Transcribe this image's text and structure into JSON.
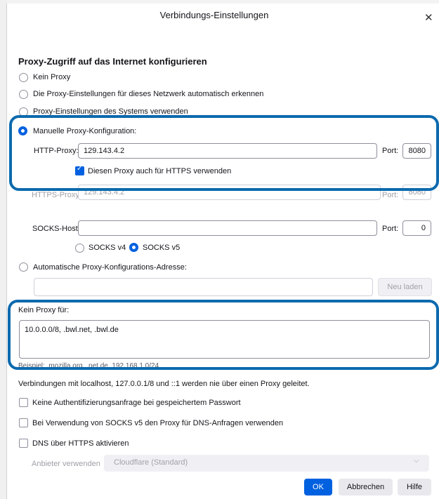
{
  "dialog": {
    "title": "Verbindungs-Einstellungen",
    "close_glyph": "✕"
  },
  "section_title": "Proxy-Zugriff auf das Internet konfigurieren",
  "proxy_options": {
    "none": "Kein Proxy",
    "auto_detect": "Die Proxy-Einstellungen für dieses Netzwerk automatisch erkennen",
    "system": "Proxy-Einstellungen des Systems verwenden",
    "manual": "Manuelle Proxy-Konfiguration:",
    "selected": "manual"
  },
  "http_proxy": {
    "label": "HTTP-Proxy:",
    "value": "129.143.4.2",
    "port_label": "Port:",
    "port": "8080"
  },
  "https_same_checkbox": {
    "label": "Diesen Proxy auch für HTTPS verwenden",
    "checked": true,
    "check_glyph": "✓"
  },
  "https_proxy": {
    "label": "HTTPS-Proxy:",
    "value": "129.143.4.2",
    "port_label": "Port:",
    "port": "8080"
  },
  "socks": {
    "label": "SOCKS-Host:",
    "value": "",
    "port_label": "Port:",
    "port": "0",
    "v4": "SOCKS v4",
    "v5": "SOCKS v5",
    "selected": "v5"
  },
  "auto_config": {
    "label": "Automatische Proxy-Konfigurations-Adresse:",
    "value": "",
    "reload": "Neu laden"
  },
  "no_proxy": {
    "label": "Kein Proxy für:",
    "value": "10.0.0.0/8, .bwl.net, .bwl.de",
    "example": "Beispiel: .mozilla.org, .net.de, 192.168.1.0/24"
  },
  "localhost_note": "Verbindungen mit localhost, 127.0.0.1/8 und ::1 werden nie über einen Proxy geleitet.",
  "options": {
    "no_auth_prompt": "Keine Authentifizierungsanfrage bei gespeichertem Passwort",
    "socks_dns": "Bei Verwendung von SOCKS v5 den Proxy für DNS-Anfragen verwenden",
    "dns_https": "DNS über HTTPS aktivieren"
  },
  "provider": {
    "label": "Anbieter verwenden",
    "value": "Cloudflare (Standard)",
    "chevron": "⌵"
  },
  "buttons": {
    "ok": "OK",
    "cancel": "Abbrechen",
    "help": "Hilfe"
  },
  "colors": {
    "accent": "#0061e0",
    "highlight": "#0c6aae"
  }
}
